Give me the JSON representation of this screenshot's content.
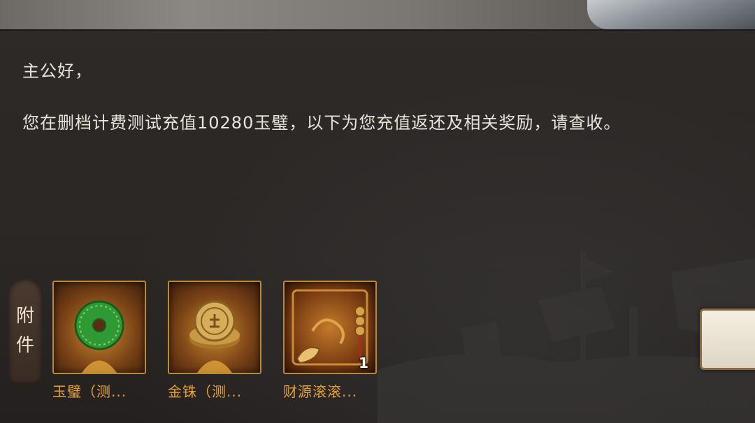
{
  "mail": {
    "greeting": "主公好，",
    "body": "您在删档计费测试充值10280玉璧，以下为您充值返还及相关奖励，请查收。"
  },
  "attachments": {
    "label_char_1": "附",
    "label_char_2": "件",
    "items": [
      {
        "name": "玉璧（测...",
        "icon": "jade-disc-icon"
      },
      {
        "name": "金铢（测...",
        "icon": "gold-coin-icon"
      },
      {
        "name": "财源滚滚...",
        "icon": "wealth-scroll-icon",
        "count": "1"
      }
    ]
  },
  "colors": {
    "item_name": "#e6a237",
    "text": "#e9e3da",
    "frame_border": "#b88a32"
  }
}
